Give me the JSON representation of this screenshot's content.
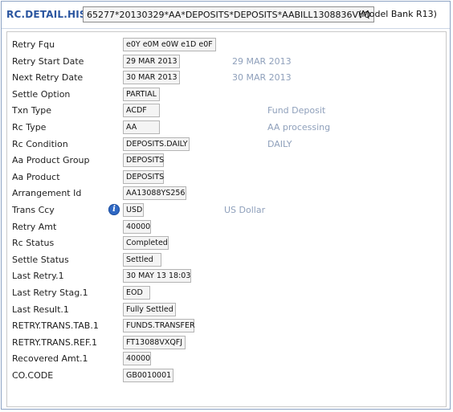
{
  "header": {
    "title": "RC.DETAIL.HIST",
    "record_id": "65277*20130329*AA*DEPOSITS*DEPOSITS*AABILL1308836VYQ",
    "version": "(Model Bank R13)"
  },
  "fields": [
    {
      "label": "Retry Fqu",
      "value": "e0Y e0M e0W e1D e0F"
    },
    {
      "label": "Retry Start Date",
      "value": "29 MAR 2013",
      "enrichment": "29 MAR 2013"
    },
    {
      "label": "Next Retry Date",
      "value": "30 MAR 2013",
      "enrichment": "30 MAR 2013"
    },
    {
      "label": "Settle Option",
      "value": "PARTIAL"
    },
    {
      "label": "Txn Type",
      "value": "ACDF",
      "enrichment": "Fund Deposit"
    },
    {
      "label": "Rc Type",
      "value": "AA",
      "enrichment": "AA processing"
    },
    {
      "label": "Rc Condition",
      "value": "DEPOSITS.DAILY",
      "enrichment": "DAILY"
    },
    {
      "label": "Aa Product Group",
      "value": "DEPOSITS"
    },
    {
      "label": "Aa Product",
      "value": "DEPOSITS"
    },
    {
      "label": "Arrangement Id",
      "value": "AA13088YS256"
    },
    {
      "label": "Trans Ccy",
      "value": "USD",
      "enrichment": "US Dollar",
      "icon": "info-icon"
    },
    {
      "label": "Retry Amt",
      "value": "40000"
    },
    {
      "label": "Rc Status",
      "value": "Completed"
    },
    {
      "label": "Settle Status",
      "value": "Settled"
    },
    {
      "label": "Last Retry.1",
      "value": "30 MAY 13 18:03"
    },
    {
      "label": "Last Retry Stag.1",
      "value": "EOD"
    },
    {
      "label": "Last Result.1",
      "value": "Fully Settled"
    },
    {
      "label": "RETRY.TRANS.TAB.1",
      "value": "FUNDS.TRANSFER"
    },
    {
      "label": "RETRY.TRANS.REF.1",
      "value": "FT13088VXQFJ"
    },
    {
      "label": "Recovered Amt.1",
      "value": "40000"
    },
    {
      "label": "CO.CODE",
      "value": "GB0010001"
    }
  ],
  "colors": {
    "title": "#2a55a0",
    "enrichment": "#8fa0bb",
    "info_icon": "#2f68c4",
    "border": "#8da3c4"
  }
}
